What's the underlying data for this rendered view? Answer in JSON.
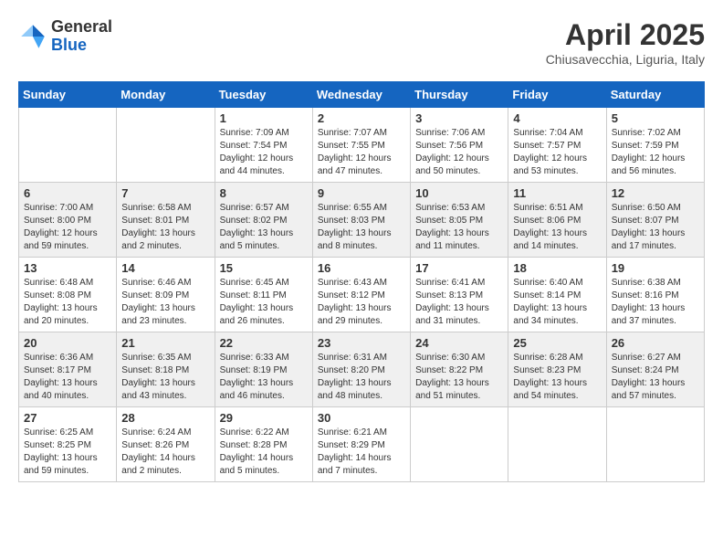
{
  "header": {
    "logo_general": "General",
    "logo_blue": "Blue",
    "month": "April 2025",
    "location": "Chiusavecchia, Liguria, Italy"
  },
  "days_of_week": [
    "Sunday",
    "Monday",
    "Tuesday",
    "Wednesday",
    "Thursday",
    "Friday",
    "Saturday"
  ],
  "weeks": [
    [
      {
        "day": "",
        "info": ""
      },
      {
        "day": "",
        "info": ""
      },
      {
        "day": "1",
        "info": "Sunrise: 7:09 AM\nSunset: 7:54 PM\nDaylight: 12 hours and 44 minutes."
      },
      {
        "day": "2",
        "info": "Sunrise: 7:07 AM\nSunset: 7:55 PM\nDaylight: 12 hours and 47 minutes."
      },
      {
        "day": "3",
        "info": "Sunrise: 7:06 AM\nSunset: 7:56 PM\nDaylight: 12 hours and 50 minutes."
      },
      {
        "day": "4",
        "info": "Sunrise: 7:04 AM\nSunset: 7:57 PM\nDaylight: 12 hours and 53 minutes."
      },
      {
        "day": "5",
        "info": "Sunrise: 7:02 AM\nSunset: 7:59 PM\nDaylight: 12 hours and 56 minutes."
      }
    ],
    [
      {
        "day": "6",
        "info": "Sunrise: 7:00 AM\nSunset: 8:00 PM\nDaylight: 12 hours and 59 minutes."
      },
      {
        "day": "7",
        "info": "Sunrise: 6:58 AM\nSunset: 8:01 PM\nDaylight: 13 hours and 2 minutes."
      },
      {
        "day": "8",
        "info": "Sunrise: 6:57 AM\nSunset: 8:02 PM\nDaylight: 13 hours and 5 minutes."
      },
      {
        "day": "9",
        "info": "Sunrise: 6:55 AM\nSunset: 8:03 PM\nDaylight: 13 hours and 8 minutes."
      },
      {
        "day": "10",
        "info": "Sunrise: 6:53 AM\nSunset: 8:05 PM\nDaylight: 13 hours and 11 minutes."
      },
      {
        "day": "11",
        "info": "Sunrise: 6:51 AM\nSunset: 8:06 PM\nDaylight: 13 hours and 14 minutes."
      },
      {
        "day": "12",
        "info": "Sunrise: 6:50 AM\nSunset: 8:07 PM\nDaylight: 13 hours and 17 minutes."
      }
    ],
    [
      {
        "day": "13",
        "info": "Sunrise: 6:48 AM\nSunset: 8:08 PM\nDaylight: 13 hours and 20 minutes."
      },
      {
        "day": "14",
        "info": "Sunrise: 6:46 AM\nSunset: 8:09 PM\nDaylight: 13 hours and 23 minutes."
      },
      {
        "day": "15",
        "info": "Sunrise: 6:45 AM\nSunset: 8:11 PM\nDaylight: 13 hours and 26 minutes."
      },
      {
        "day": "16",
        "info": "Sunrise: 6:43 AM\nSunset: 8:12 PM\nDaylight: 13 hours and 29 minutes."
      },
      {
        "day": "17",
        "info": "Sunrise: 6:41 AM\nSunset: 8:13 PM\nDaylight: 13 hours and 31 minutes."
      },
      {
        "day": "18",
        "info": "Sunrise: 6:40 AM\nSunset: 8:14 PM\nDaylight: 13 hours and 34 minutes."
      },
      {
        "day": "19",
        "info": "Sunrise: 6:38 AM\nSunset: 8:16 PM\nDaylight: 13 hours and 37 minutes."
      }
    ],
    [
      {
        "day": "20",
        "info": "Sunrise: 6:36 AM\nSunset: 8:17 PM\nDaylight: 13 hours and 40 minutes."
      },
      {
        "day": "21",
        "info": "Sunrise: 6:35 AM\nSunset: 8:18 PM\nDaylight: 13 hours and 43 minutes."
      },
      {
        "day": "22",
        "info": "Sunrise: 6:33 AM\nSunset: 8:19 PM\nDaylight: 13 hours and 46 minutes."
      },
      {
        "day": "23",
        "info": "Sunrise: 6:31 AM\nSunset: 8:20 PM\nDaylight: 13 hours and 48 minutes."
      },
      {
        "day": "24",
        "info": "Sunrise: 6:30 AM\nSunset: 8:22 PM\nDaylight: 13 hours and 51 minutes."
      },
      {
        "day": "25",
        "info": "Sunrise: 6:28 AM\nSunset: 8:23 PM\nDaylight: 13 hours and 54 minutes."
      },
      {
        "day": "26",
        "info": "Sunrise: 6:27 AM\nSunset: 8:24 PM\nDaylight: 13 hours and 57 minutes."
      }
    ],
    [
      {
        "day": "27",
        "info": "Sunrise: 6:25 AM\nSunset: 8:25 PM\nDaylight: 13 hours and 59 minutes."
      },
      {
        "day": "28",
        "info": "Sunrise: 6:24 AM\nSunset: 8:26 PM\nDaylight: 14 hours and 2 minutes."
      },
      {
        "day": "29",
        "info": "Sunrise: 6:22 AM\nSunset: 8:28 PM\nDaylight: 14 hours and 5 minutes."
      },
      {
        "day": "30",
        "info": "Sunrise: 6:21 AM\nSunset: 8:29 PM\nDaylight: 14 hours and 7 minutes."
      },
      {
        "day": "",
        "info": ""
      },
      {
        "day": "",
        "info": ""
      },
      {
        "day": "",
        "info": ""
      }
    ]
  ]
}
